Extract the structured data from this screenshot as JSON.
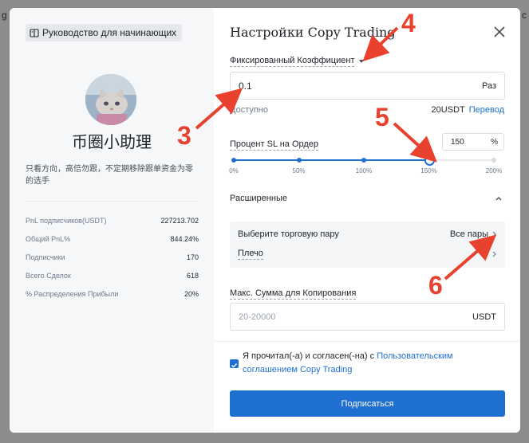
{
  "background": {
    "edge_text_left": "g",
    "edge_text_right": "c"
  },
  "left_panel": {
    "guide_button": "Руководство для начинающих",
    "trader_name": "币圈小助理",
    "bio": "只看方向，高倍勿跟，不定期移除跟单资金为零的选手",
    "stats": [
      {
        "label": "PnL подписчиков(USDT)",
        "value": "227213.702"
      },
      {
        "label": "Общий PnL%",
        "value": "844.24%"
      },
      {
        "label": "Подписчики",
        "value": "170"
      },
      {
        "label": "Всего Сделок",
        "value": "618"
      },
      {
        "label": "% Распределения Прибыли",
        "value": "20%"
      }
    ]
  },
  "settings": {
    "title": "Настройки Copy Trading",
    "coefficient_label": "Фиксированный Коэффициент",
    "coefficient_value": "0.1",
    "coefficient_unit": "Раз",
    "available_label": "Доступно",
    "available_amount": "20USDT",
    "transfer_link": "Перевод",
    "sl_label": "Процент SL на Ордер",
    "sl_value": "150",
    "sl_unit": "%",
    "slider": {
      "value_percent": 150,
      "max_percent": 200,
      "marks": [
        "0%",
        "50%",
        "100%",
        "150%",
        "200%"
      ],
      "accent": "#1f6fd0"
    },
    "advanced_label": "Расширенные",
    "pair_label": "Выберите торговую пару",
    "pair_value": "Все пары",
    "leverage_label": "Плечо",
    "max_amount_label": "Макс. Сумма для Копирования",
    "max_amount_placeholder": "20-20000",
    "max_amount_unit": "USDT",
    "agree_text": "Я прочитал(-а) и согласен(-на) с",
    "agree_link": "Пользовательским соглашением Copy Trading",
    "subscribe_button": "Подписаться"
  },
  "annotations": {
    "numbers": [
      "3",
      "4",
      "5",
      "6"
    ],
    "color": "#e8412e"
  }
}
